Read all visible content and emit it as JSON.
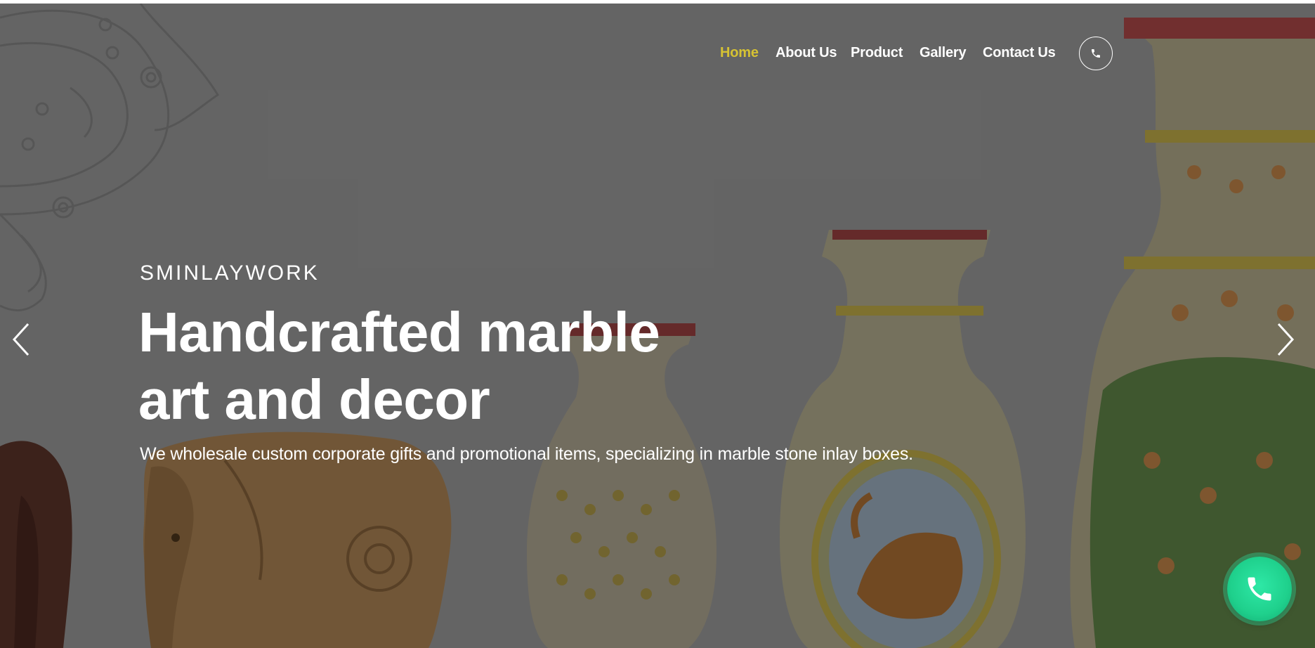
{
  "nav": {
    "items": [
      {
        "label": "Home",
        "active": true
      },
      {
        "label": "About Us",
        "active": false
      },
      {
        "label": "Product",
        "active": false
      },
      {
        "label": "Gallery",
        "active": false
      },
      {
        "label": "Contact Us",
        "active": false
      }
    ],
    "call_icon": "phone-icon"
  },
  "hero": {
    "eyebrow": "SMINLAYWORK",
    "headline_line1": "Handcrafted marble",
    "headline_line2": "art and decor",
    "subtext": "We wholesale custom corporate gifts and promotional items, specializing in marble stone inlay boxes.",
    "prev_icon": "chevron-left-icon",
    "next_icon": "chevron-right-icon"
  },
  "floating_call": {
    "icon": "phone-icon"
  },
  "colors": {
    "accent_active_nav": "#d6c233",
    "overlay_gray": "#7a7a7a",
    "call_button_green": "#1fd08c"
  }
}
